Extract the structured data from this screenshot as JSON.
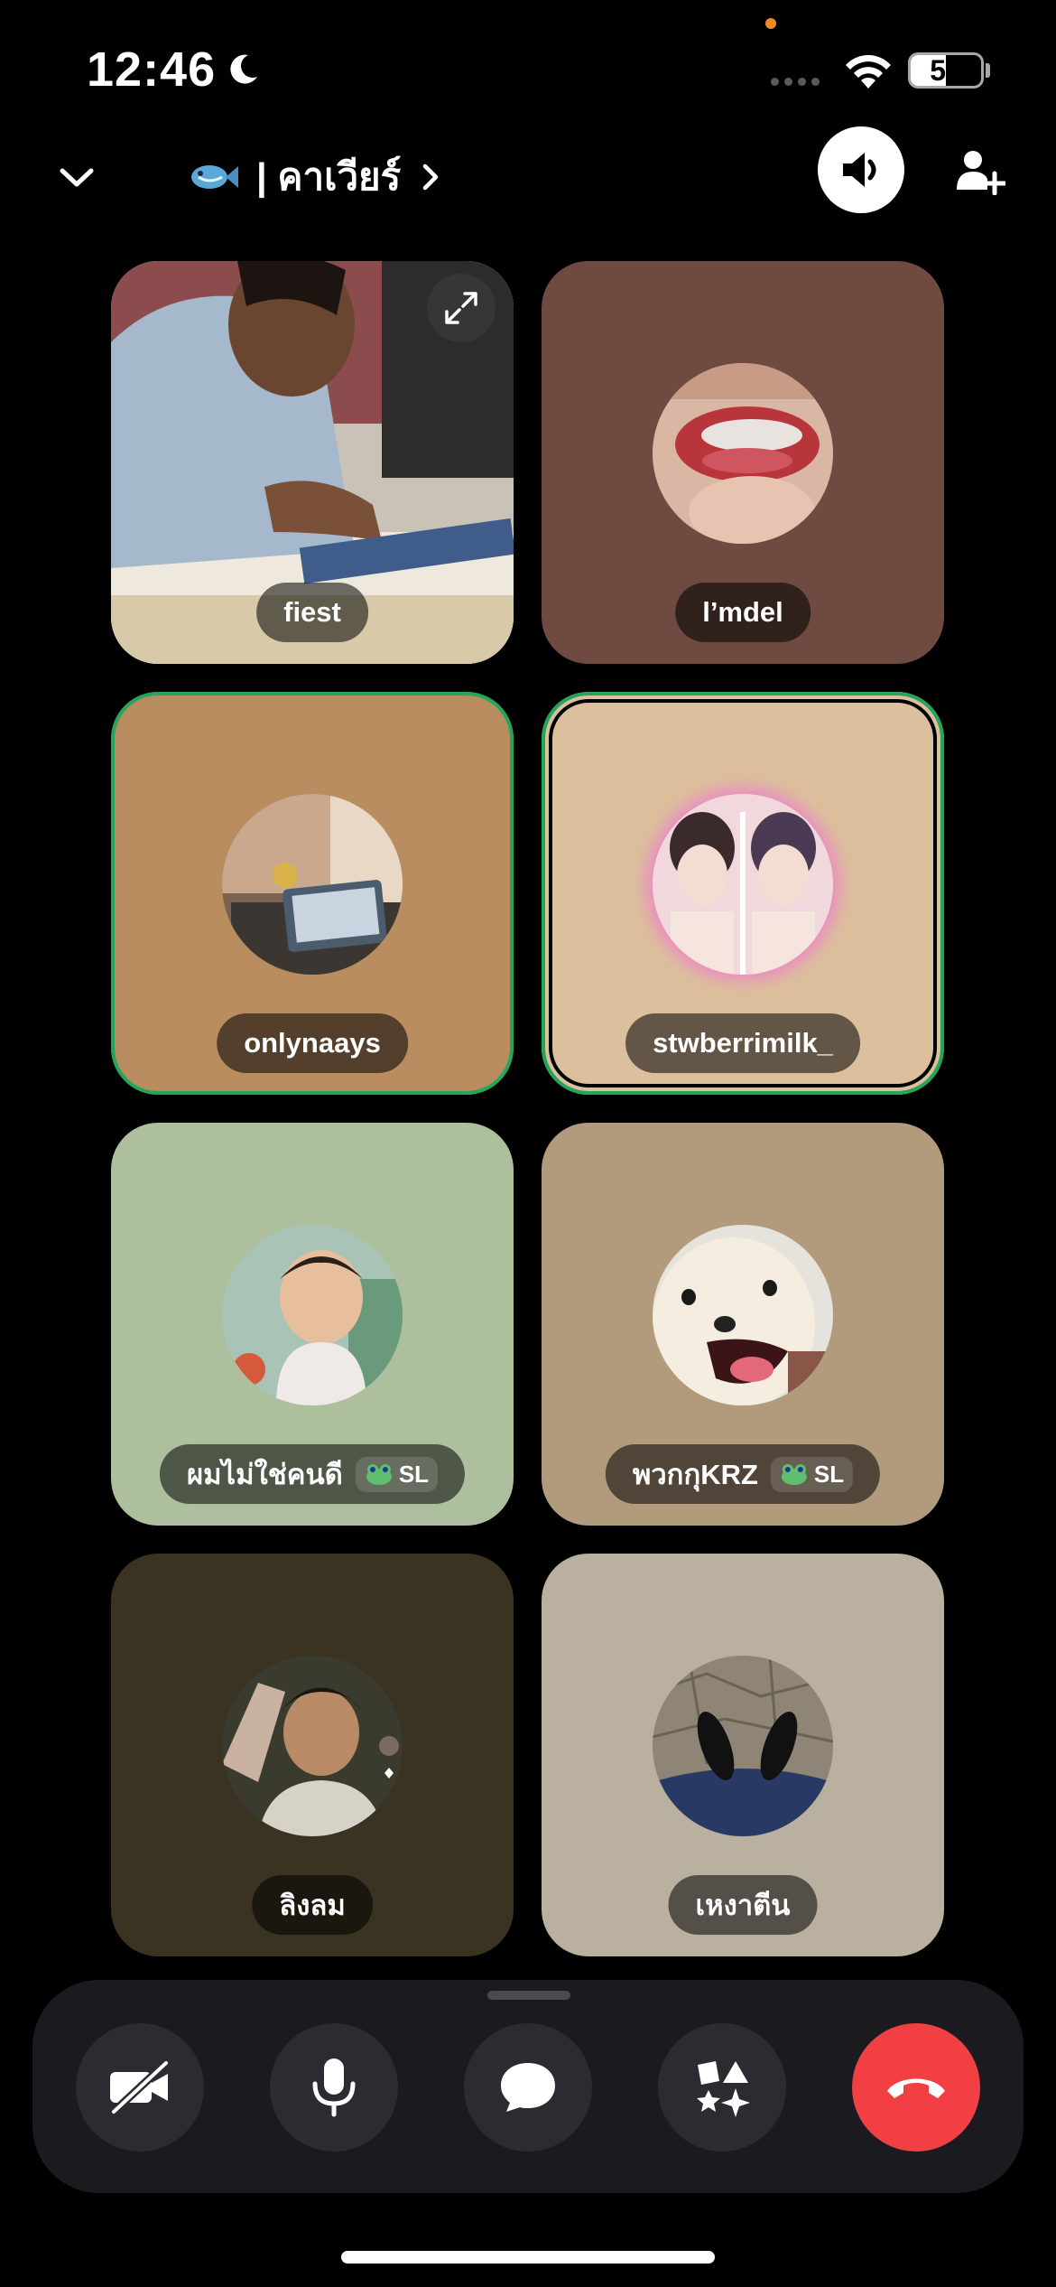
{
  "status_bar": {
    "time": "12:46",
    "battery": "50",
    "battery_level_percent": 50
  },
  "header": {
    "channel_emoji": "🐟",
    "channel_name": "| คาเวียร์"
  },
  "participants": [
    {
      "name": "fiest",
      "type": "video",
      "speaking": false,
      "bg": "#d9d4cb"
    },
    {
      "name": "l’mdel",
      "type": "avatar",
      "speaking": false,
      "bg": "#6e4a41"
    },
    {
      "name": "onlynaays",
      "type": "avatar",
      "speaking": true,
      "bg": "#b98d5f"
    },
    {
      "name": "stwberrimilk_",
      "type": "avatar",
      "speaking": true,
      "bg": "#dcbf9c"
    },
    {
      "name": "ผมไม่ใช่คนดี",
      "type": "avatar",
      "speaking": false,
      "bg": "#aebf9e",
      "tag": "SL"
    },
    {
      "name": "พวกกุKRZ",
      "type": "avatar",
      "speaking": false,
      "bg": "#b29a7c",
      "tag": "SL"
    },
    {
      "name": "ลิงลม",
      "type": "avatar",
      "speaking": false,
      "bg": "#3a3322"
    },
    {
      "name": "เหงาตีน",
      "type": "avatar",
      "speaking": false,
      "bg": "#bab09f"
    }
  ],
  "controls": {
    "camera": "camera-off",
    "mic": "microphone",
    "chat": "chat",
    "activities": "activities",
    "leave": "leave-call",
    "leave_color": "#f23f43"
  }
}
